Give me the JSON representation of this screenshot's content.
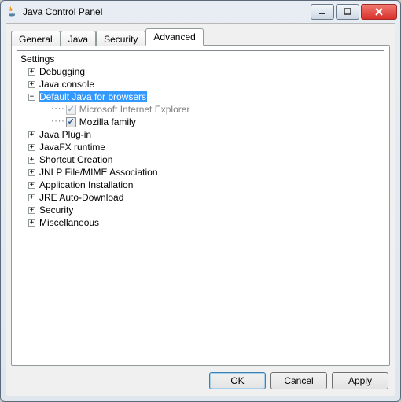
{
  "window": {
    "title": "Java Control Panel"
  },
  "tabs": {
    "general": "General",
    "java": "Java",
    "security": "Security",
    "advanced": "Advanced",
    "active": "advanced"
  },
  "tree": {
    "root": "Settings",
    "nodes": {
      "debugging": "Debugging",
      "java_console": "Java console",
      "default_java_browsers": "Default Java for browsers",
      "java_plugin": "Java Plug-in",
      "javafx_runtime": "JavaFX runtime",
      "shortcut_creation": "Shortcut Creation",
      "jnlp_mime": "JNLP File/MIME Association",
      "app_install": "Application Installation",
      "jre_auto": "JRE Auto-Download",
      "security": "Security",
      "misc": "Miscellaneous"
    },
    "children": {
      "msie": "Microsoft Internet Explorer",
      "mozilla": "Mozilla family"
    },
    "checked": {
      "msie": true,
      "mozilla": true
    },
    "disabled": {
      "msie": true,
      "mozilla": false
    },
    "selected": "default_java_browsers"
  },
  "buttons": {
    "ok": "OK",
    "cancel": "Cancel",
    "apply": "Apply"
  }
}
